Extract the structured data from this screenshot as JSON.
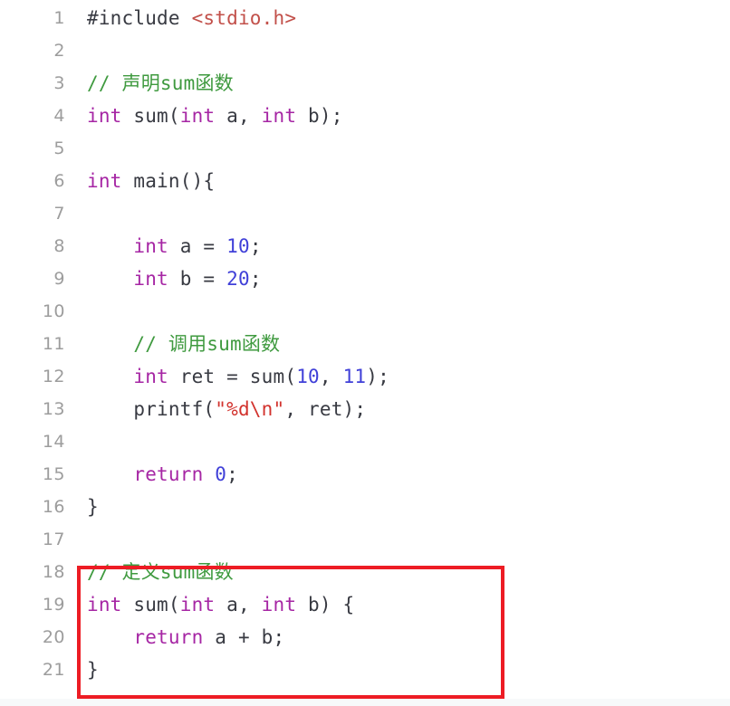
{
  "editor": {
    "language": "c",
    "background_color": "#ffffff",
    "gutter_color": "#9d9d9d",
    "colors": {
      "keyword": "#a626a4",
      "number": "#4040d8",
      "string": "#d2322d",
      "comment": "#3f9a3f",
      "include_path": "#c2504a",
      "plain": "#383a42",
      "annotation_box": "#ed1c24"
    },
    "annotation": {
      "shape": "rectangle",
      "color": "#ed1c24",
      "covers_lines": "18-21",
      "label": "sum-function-definition-highlight"
    },
    "lines": [
      {
        "number": "1",
        "tokens": [
          {
            "text": "#include ",
            "type": "plain"
          },
          {
            "text": "<stdio.h>",
            "type": "inc"
          }
        ]
      },
      {
        "number": "2",
        "tokens": []
      },
      {
        "number": "3",
        "tokens": [
          {
            "text": "// 声明sum函数",
            "type": "comment"
          }
        ]
      },
      {
        "number": "4",
        "tokens": [
          {
            "text": "int",
            "type": "kw"
          },
          {
            "text": " sum(",
            "type": "plain"
          },
          {
            "text": "int",
            "type": "kw"
          },
          {
            "text": " a, ",
            "type": "plain"
          },
          {
            "text": "int",
            "type": "kw"
          },
          {
            "text": " b);",
            "type": "plain"
          }
        ]
      },
      {
        "number": "5",
        "tokens": []
      },
      {
        "number": "6",
        "tokens": [
          {
            "text": "int",
            "type": "kw"
          },
          {
            "text": " main(){",
            "type": "plain"
          }
        ]
      },
      {
        "number": "7",
        "tokens": []
      },
      {
        "number": "8",
        "tokens": [
          {
            "text": "    ",
            "type": "plain"
          },
          {
            "text": "int",
            "type": "kw"
          },
          {
            "text": " a = ",
            "type": "plain"
          },
          {
            "text": "10",
            "type": "num"
          },
          {
            "text": ";",
            "type": "plain"
          }
        ]
      },
      {
        "number": "9",
        "tokens": [
          {
            "text": "    ",
            "type": "plain"
          },
          {
            "text": "int",
            "type": "kw"
          },
          {
            "text": " b = ",
            "type": "plain"
          },
          {
            "text": "20",
            "type": "num"
          },
          {
            "text": ";",
            "type": "plain"
          }
        ]
      },
      {
        "number": "10",
        "tokens": []
      },
      {
        "number": "11",
        "tokens": [
          {
            "text": "    ",
            "type": "plain"
          },
          {
            "text": "// 调用sum函数",
            "type": "comment"
          }
        ]
      },
      {
        "number": "12",
        "tokens": [
          {
            "text": "    ",
            "type": "plain"
          },
          {
            "text": "int",
            "type": "kw"
          },
          {
            "text": " ret = sum(",
            "type": "plain"
          },
          {
            "text": "10",
            "type": "num"
          },
          {
            "text": ", ",
            "type": "plain"
          },
          {
            "text": "11",
            "type": "num"
          },
          {
            "text": ");",
            "type": "plain"
          }
        ]
      },
      {
        "number": "13",
        "tokens": [
          {
            "text": "    printf(",
            "type": "plain"
          },
          {
            "text": "\"%d\\n\"",
            "type": "str"
          },
          {
            "text": ", ret);",
            "type": "plain"
          }
        ]
      },
      {
        "number": "14",
        "tokens": []
      },
      {
        "number": "15",
        "tokens": [
          {
            "text": "    ",
            "type": "plain"
          },
          {
            "text": "return",
            "type": "kw"
          },
          {
            "text": " ",
            "type": "plain"
          },
          {
            "text": "0",
            "type": "num"
          },
          {
            "text": ";",
            "type": "plain"
          }
        ]
      },
      {
        "number": "16",
        "tokens": [
          {
            "text": "}",
            "type": "plain"
          }
        ]
      },
      {
        "number": "17",
        "tokens": []
      },
      {
        "number": "18",
        "tokens": [
          {
            "text": "// 定义sum函数",
            "type": "comment"
          }
        ]
      },
      {
        "number": "19",
        "tokens": [
          {
            "text": "int",
            "type": "kw"
          },
          {
            "text": " sum(",
            "type": "plain"
          },
          {
            "text": "int",
            "type": "kw"
          },
          {
            "text": " a, ",
            "type": "plain"
          },
          {
            "text": "int",
            "type": "kw"
          },
          {
            "text": " b) {",
            "type": "plain"
          }
        ]
      },
      {
        "number": "20",
        "tokens": [
          {
            "text": "    ",
            "type": "plain"
          },
          {
            "text": "return",
            "type": "kw"
          },
          {
            "text": " a + b;",
            "type": "plain"
          }
        ]
      },
      {
        "number": "21",
        "tokens": [
          {
            "text": "}",
            "type": "plain"
          }
        ]
      }
    ]
  }
}
